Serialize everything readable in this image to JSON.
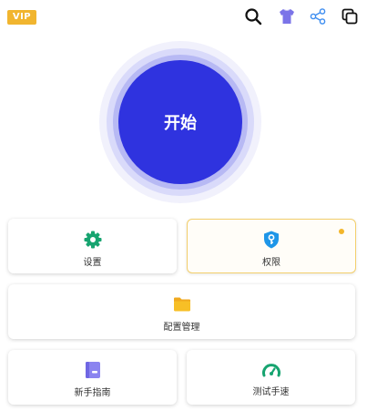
{
  "header": {
    "vip_label": "VIP",
    "icons": [
      "search-icon",
      "theme-shirt-icon",
      "share-icon",
      "copy-icon"
    ]
  },
  "start": {
    "label": "开始"
  },
  "cards": {
    "settings": {
      "label": "设置",
      "icon": "gear-icon"
    },
    "permissions": {
      "label": "权限",
      "icon": "shield-key-icon",
      "badge": "notification-dot"
    },
    "config": {
      "label": "配置管理",
      "icon": "folder-icon"
    },
    "guide": {
      "label": "新手指南",
      "icon": "book-icon"
    },
    "speed": {
      "label": "测试手速",
      "icon": "speedometer-icon"
    }
  },
  "colors": {
    "accent": "#2f33df",
    "vip": "#f1b52f",
    "green": "#17a470",
    "blue": "#1e96e8",
    "folder": "#f7bf26",
    "purple": "#8b84f0"
  }
}
